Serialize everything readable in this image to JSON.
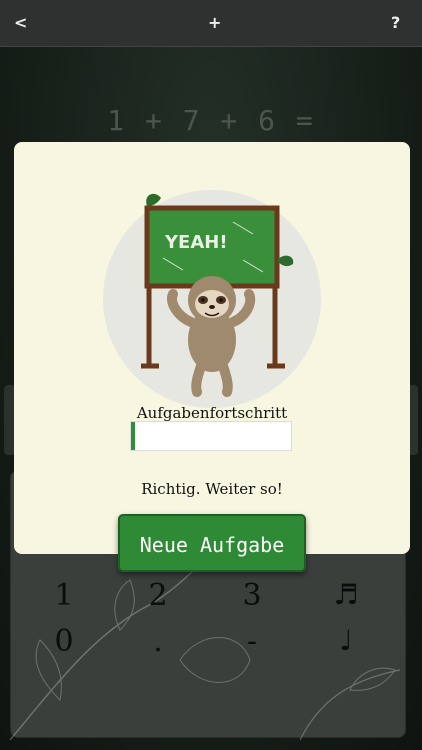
{
  "topbar": {
    "back_icon": "<",
    "add_icon": "+",
    "help_icon": "?"
  },
  "equation": "1 + 7 + 6 =",
  "keypad": {
    "keys_row1": [
      "1",
      "2",
      "3",
      "♬"
    ],
    "keys_row2": [
      "0",
      ".",
      "-",
      "♩"
    ]
  },
  "modal": {
    "image_text": "YEAH!",
    "progress_label": "Aufgabenfortschritt",
    "progress_fraction": 0.02,
    "status_text": "Richtig. Weiter so!",
    "new_task_button": "Neue Aufgabe"
  },
  "colors": {
    "accent_green": "#2f8a35",
    "modal_bg": "#f7f6e0",
    "topbar_bg": "#2e312f"
  }
}
